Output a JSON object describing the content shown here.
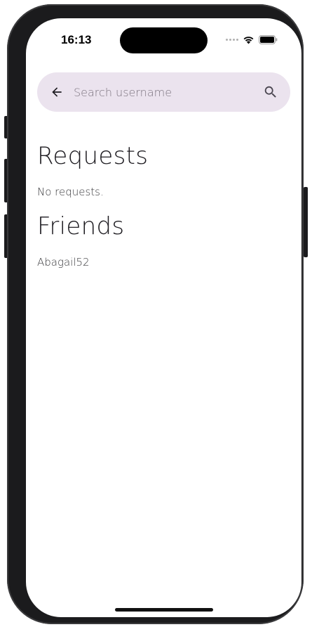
{
  "status_bar": {
    "time": "16:13",
    "icons": [
      "signal-dots-icon",
      "wifi-icon",
      "battery-icon"
    ]
  },
  "search": {
    "placeholder": "Search username",
    "value": "",
    "back_icon": "arrow-back-icon",
    "search_icon": "search-icon"
  },
  "requests": {
    "title": "Requests",
    "empty_text": "No requests."
  },
  "friends": {
    "title": "Friends",
    "items": [
      {
        "username": "Abagail52"
      }
    ]
  },
  "colors": {
    "search_bar_bg": "#ebe3ee",
    "text": "#1d1b20"
  }
}
